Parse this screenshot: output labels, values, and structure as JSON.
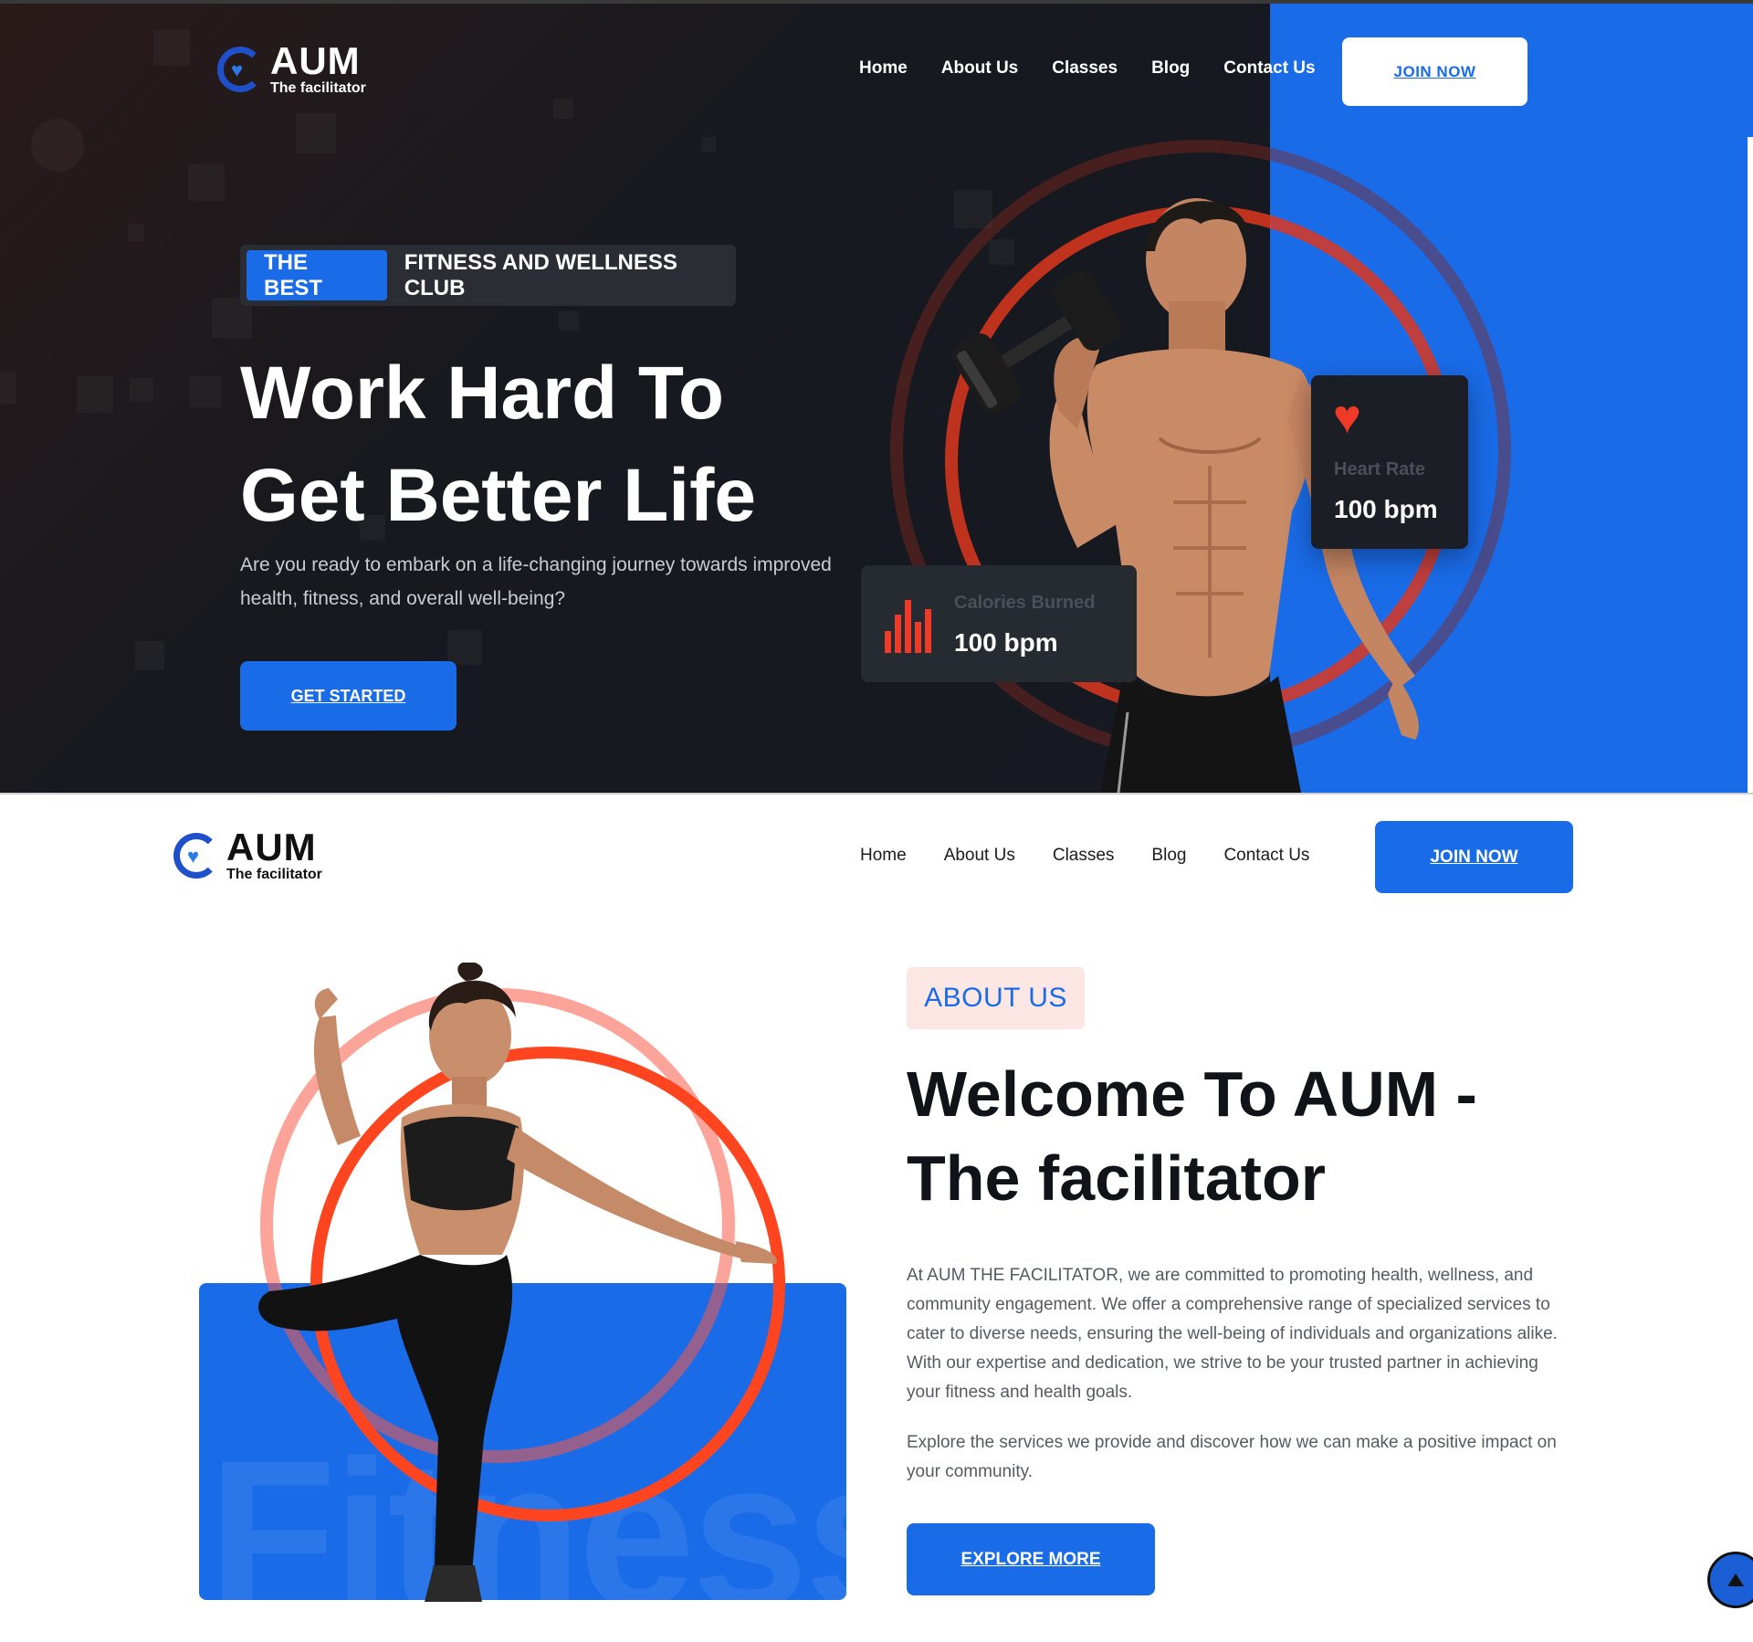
{
  "brand": {
    "name": "AUM",
    "tagline": "The facilitator"
  },
  "nav": {
    "items": [
      "Home",
      "About Us",
      "Classes",
      "Blog",
      "Contact Us"
    ],
    "cta": "JOIN NOW"
  },
  "hero": {
    "tag_highlight": "THE BEST",
    "tag_text": "FITNESS AND WELLNESS CLUB",
    "heading_line1": "Work Hard To",
    "heading_line2": "Get Better Life",
    "description": "Are you ready to embark on a life-changing journey towards improved health, fitness, and overall well-being?",
    "cta": "GET STARTED",
    "stats": {
      "heart_rate_label": "Heart Rate",
      "heart_rate_value": "100 bpm",
      "calories_label": "Calories Burned",
      "calories_value": "100 bpm"
    }
  },
  "about": {
    "pill": "ABOUT US",
    "heading_line1": "Welcome To AUM -",
    "heading_line2": "The facilitator",
    "paragraph1": "At AUM THE FACILITATOR, we are committed to promoting health, wellness, and community engagement. We offer a comprehensive range of specialized services to cater to diverse needs, ensuring the well-being of individuals and organizations alike. With our expertise and dedication, we strive to be your trusted partner in achieving your fitness and health goals.",
    "paragraph2": "Explore the services we provide and discover how we can make a positive impact on your community.",
    "cta": "EXPLORE MORE",
    "background_word": "Fitness"
  },
  "icons": {
    "logo": "heart-hands-logo-icon",
    "heart": "heart-icon",
    "calories": "bar-chart-icon",
    "scroll_top": "arrow-up-icon"
  },
  "colors": {
    "accent": "#1a6be8",
    "hero_bg": "#161922",
    "ring": "#ff4420",
    "heart": "#f03a28",
    "pill_bg": "#fde7e4"
  }
}
